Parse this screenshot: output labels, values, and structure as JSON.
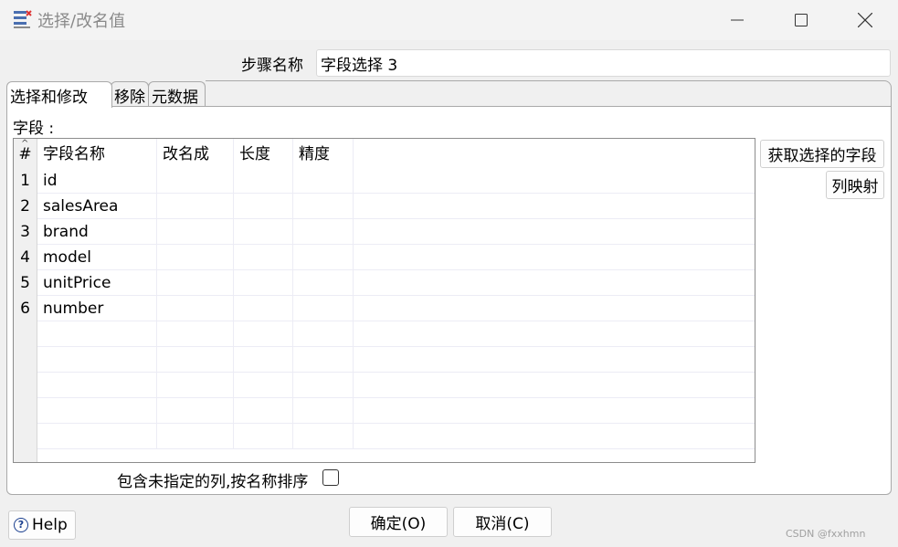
{
  "window": {
    "title": "选择/改名值",
    "icon": "select-rename-icon",
    "controls": [
      "minimize-icon",
      "maximize-icon",
      "close-icon"
    ]
  },
  "step": {
    "label": "步骤名称",
    "value": "字段选择 3"
  },
  "tabs": [
    {
      "label": "选择和修改",
      "active": true
    },
    {
      "label": "移除",
      "active": false
    },
    {
      "label": "元数据",
      "active": false
    }
  ],
  "fields": {
    "label": "字段 :",
    "columns": [
      "#",
      "字段名称",
      "改名成",
      "长度",
      "精度"
    ],
    "rows": [
      {
        "num": "1",
        "name": "id",
        "rename": "",
        "length": "",
        "precision": ""
      },
      {
        "num": "2",
        "name": "salesArea",
        "rename": "",
        "length": "",
        "precision": ""
      },
      {
        "num": "3",
        "name": "brand",
        "rename": "",
        "length": "",
        "precision": ""
      },
      {
        "num": "4",
        "name": "model",
        "rename": "",
        "length": "",
        "precision": ""
      },
      {
        "num": "5",
        "name": "unitPrice",
        "rename": "",
        "length": "",
        "precision": ""
      },
      {
        "num": "6",
        "name": "number",
        "rename": "",
        "length": "",
        "precision": ""
      }
    ]
  },
  "buttons": {
    "get_fields": "获取选择的字段",
    "column_mapping": "列映射",
    "help": "Help",
    "ok": "确定(O)",
    "cancel": "取消(C)"
  },
  "include_unspecified": {
    "label": "包含未指定的列,按名称排序",
    "checked": false
  },
  "watermark": "CSDN @fxxhmn"
}
